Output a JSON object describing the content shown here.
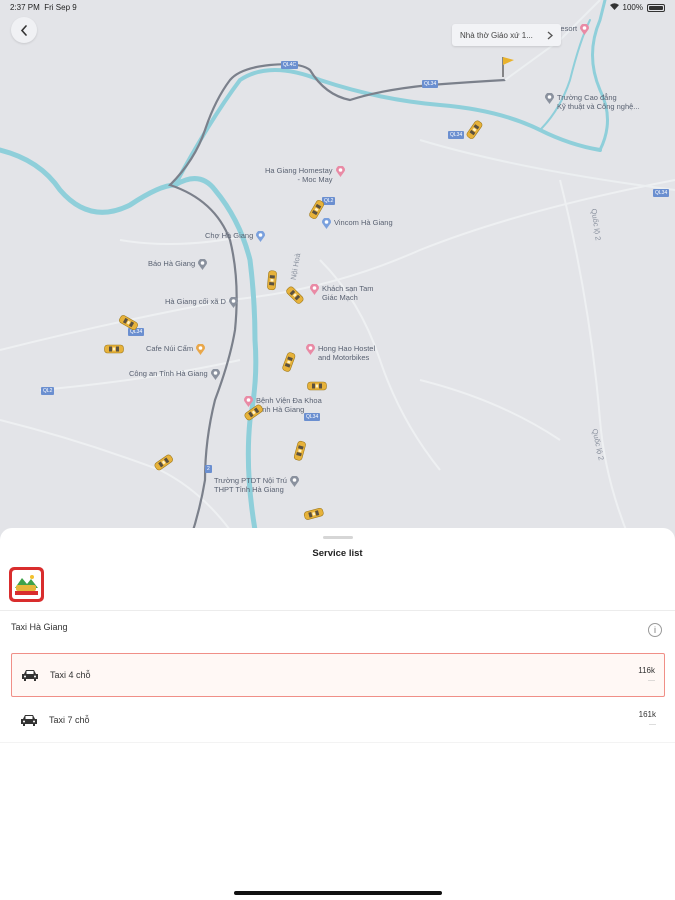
{
  "status_bar": {
    "time": "2:37 PM",
    "date": "Fri Sep 9",
    "battery": "100%"
  },
  "map": {
    "destination_label": "Nhà thờ Giáo xứ 1...",
    "pois": {
      "resort": "Resort",
      "college": "Trường Cao đẳng\nKỹ thuật và Công nghệ...",
      "homestay": "Ha Giang Homestay\n- Moc May",
      "vincom": "Vincom Hà Giang",
      "market": "Chợ Hà Giang",
      "newspaper": "Báo Hà Giang",
      "hotel_tam": "Khách sạn Tam\nGiác Mạch",
      "old_hg": "Hà Giang cối xã D",
      "hong_hao": "Hong Hao Hostel\nand Motorbikes",
      "cafe": "Cafe Núi Cấm",
      "police": "Công an Tỉnh Hà Giang",
      "hospital": "Bệnh Viện Đa Khoa\nTỉnh Hà Giang",
      "school": "Trường PTDT Nội Trú\nTHPT Tỉnh Hà Giang"
    },
    "road_shields": [
      "QL4C",
      "QL34",
      "QL34",
      "QL34",
      "QL2",
      "QL34",
      "QL2",
      "QL34",
      "2"
    ],
    "street_labels": [
      "Quốc lộ 2",
      "Quốc lộ 2",
      "Nội Hoà"
    ]
  },
  "sheet": {
    "title": "Service list",
    "company": "Taxi Hà Giang",
    "info_icon": "i",
    "services": [
      {
        "name": "Taxi 4 chỗ",
        "price": "116k",
        "sub": "—",
        "selected": true
      },
      {
        "name": "Taxi 7 chỗ",
        "price": "161k",
        "sub": "—",
        "selected": false
      }
    ]
  },
  "colors": {
    "accent": "#f08f87",
    "brand_red": "#d92d2d",
    "map_bg": "#e7e8ec",
    "river": "#8ed4dc",
    "taxi": "#e7b23a"
  }
}
